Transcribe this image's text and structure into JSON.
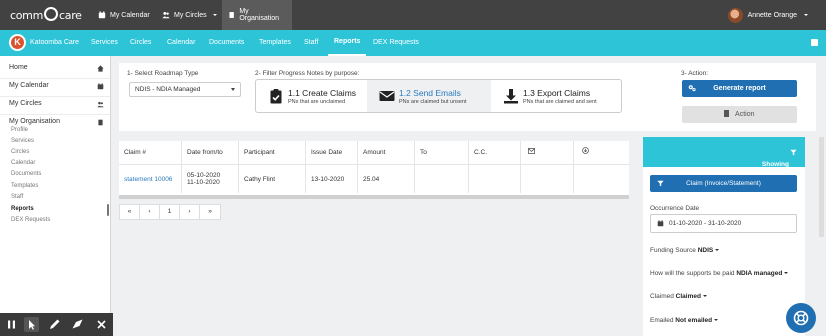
{
  "topbar": {
    "brand": "comm care",
    "nav": [
      {
        "label": "My Calendar",
        "icon": "calendar-icon"
      },
      {
        "label": "My Circles",
        "icon": "users-icon"
      },
      {
        "label": "My Organisation",
        "icon": "building-icon"
      }
    ],
    "user_name": "Annette Orange"
  },
  "orgbar": {
    "org_name": "Katoomba Care",
    "tabs": [
      "Services",
      "Circles",
      "Calendar",
      "Documents",
      "Templates",
      "Staff",
      "Reports",
      "DEX Requests"
    ],
    "active_tab": "Reports"
  },
  "sidebar": {
    "items": [
      {
        "label": "Home",
        "icon": "home-icon"
      },
      {
        "label": "My Calendar",
        "icon": "calendar-icon"
      },
      {
        "label": "My Circles",
        "icon": "users-icon"
      },
      {
        "label": "My Organisation",
        "icon": "building-icon"
      }
    ],
    "sub_items": [
      "Profile",
      "Services",
      "Circles",
      "Calendar",
      "Documents",
      "Templates",
      "Staff",
      "Reports",
      "DEX Requests"
    ],
    "active_sub": "Reports"
  },
  "filters": {
    "roadmap_label": "1- Select Roadmap Type",
    "roadmap_value": "NDIS - NDIA Managed",
    "purpose_label": "2- Filter Progress Notes by purpose:",
    "options": [
      {
        "title": "1.1 Create Claims",
        "subtitle": "PNs that are unclaimed",
        "icon": "clipboard-check-icon"
      },
      {
        "title": "1.2 Send Emails",
        "subtitle": "PNs are claimed but unsent",
        "icon": "envelope-icon"
      },
      {
        "title": "1.3 Export Claims",
        "subtitle": "PNs that are claimed and sent",
        "icon": "download-icon"
      }
    ],
    "action_label": "3- Action:",
    "generate_label": "Generate report",
    "action_button_label": "Action"
  },
  "table": {
    "headers": [
      "Claim #",
      "Date from/to",
      "Participant",
      "Issue Date",
      "Amount",
      "To",
      "C.C.",
      "",
      ""
    ],
    "rows": [
      {
        "claim": "statement 10006",
        "date_from": "05-10-2020",
        "date_to": "11-10-2020",
        "participant": "Cathy Flint",
        "issue_date": "13-10-2020",
        "amount": "25.04",
        "to": "",
        "cc": ""
      }
    ],
    "pager": [
      "«",
      "‹",
      "1",
      "›",
      "»"
    ]
  },
  "right_panel": {
    "showing": "Showing Docs 1/111",
    "claim_button": "Claim (Invoice/Statement)",
    "occurrence_label": "Occurrence Date",
    "date_range": "01-10-2020 - 31-10-2020",
    "funding_label": "Funding Source",
    "funding_value": "NDIS",
    "paid_label": "How will the supports be paid",
    "paid_value": "NDIA managed",
    "claimed_label": "Claimed",
    "claimed_value": "Claimed",
    "emailed_label": "Emailed",
    "emailed_value": "Not emailed"
  },
  "colors": {
    "cyan": "#2ec4d8",
    "topbar": "#424242",
    "primary_button": "#1f6fb2",
    "link": "#2c7bbf"
  }
}
